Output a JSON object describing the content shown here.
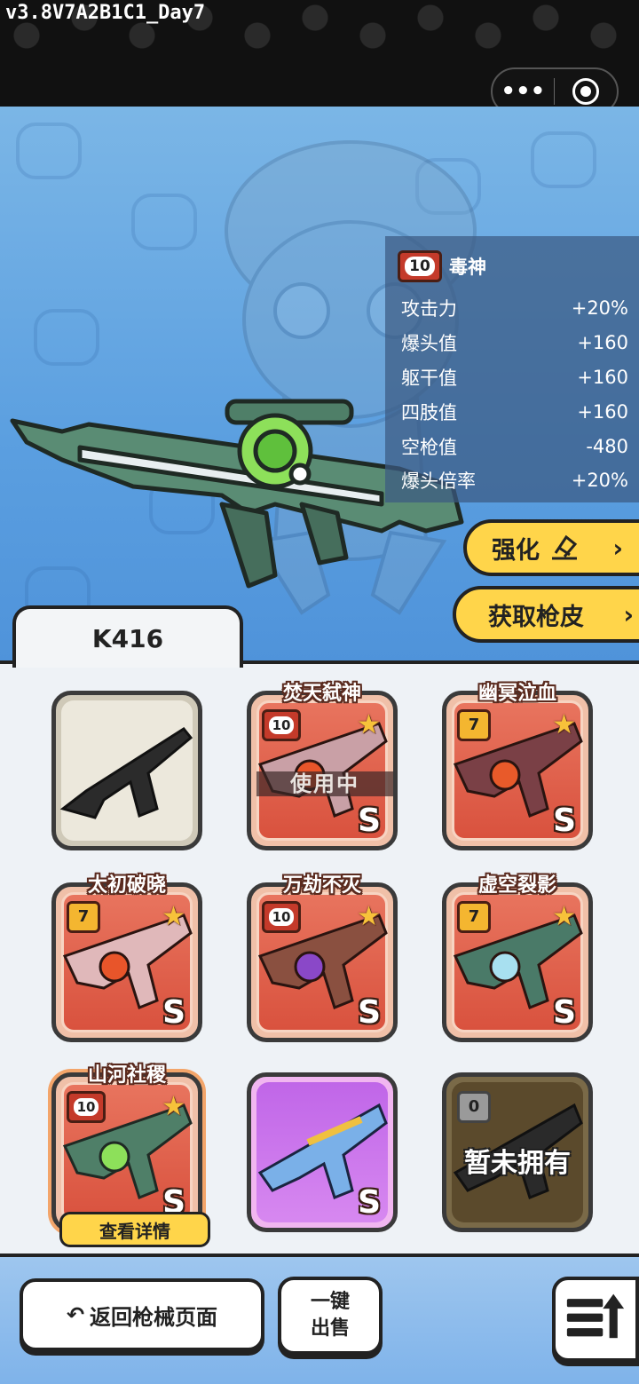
{
  "header": {
    "version": "v3.8V7A2B1C1_Day7",
    "more_icon": "more-dots-icon",
    "close_icon": "target-close-icon"
  },
  "selected_skin": {
    "level": "10",
    "title": "毒神",
    "stats": [
      {
        "label": "攻击力",
        "value": "+20%"
      },
      {
        "label": "爆头值",
        "value": "+160"
      },
      {
        "label": "躯干值",
        "value": "+160"
      },
      {
        "label": "四肢值",
        "value": "+160"
      },
      {
        "label": "空枪值",
        "value": "-480"
      },
      {
        "label": "爆头倍率",
        "value": "+20%"
      }
    ]
  },
  "actions": {
    "enhance_label": "强化",
    "get_skin_label": "获取枪皮",
    "chevron": "›"
  },
  "weapon": {
    "name": "K416"
  },
  "skins": [
    {
      "name": "",
      "level": "",
      "style": "default",
      "grade": "",
      "star": false
    },
    {
      "name": "焚天弑神",
      "level": "10",
      "style": "red",
      "grade": "S",
      "star": true,
      "status": "使用中"
    },
    {
      "name": "幽冥泣血",
      "level": "7",
      "style": "red",
      "grade": "S",
      "star": true
    },
    {
      "name": "太初破晓",
      "level": "7",
      "style": "red",
      "grade": "S",
      "star": true
    },
    {
      "name": "万劫不灭",
      "level": "10",
      "style": "red",
      "grade": "S",
      "star": true
    },
    {
      "name": "虚空裂影",
      "level": "7",
      "style": "red",
      "grade": "S",
      "star": true
    },
    {
      "name": "山河社稷",
      "level": "10",
      "style": "red",
      "grade": "S",
      "star": true,
      "detail": "查看详情"
    },
    {
      "name": "",
      "level": "",
      "style": "purple",
      "grade": "S",
      "star": false
    },
    {
      "name": "",
      "level": "0",
      "style": "locked",
      "grade": "",
      "star": false,
      "status": "暂未拥有"
    }
  ],
  "footer": {
    "back_label": "返回枪械页面",
    "sell_line1": "一键",
    "sell_line2": "出售",
    "back_arrow": "↶",
    "menu_icon": "list-upload-icon"
  },
  "colors": {
    "accent_yellow": "#ffd54a",
    "card_red": "#d9523e",
    "level10_badge": "#c43a2a",
    "level7_badge": "#f4b630",
    "showcase_blue": "#5b9fe0"
  }
}
